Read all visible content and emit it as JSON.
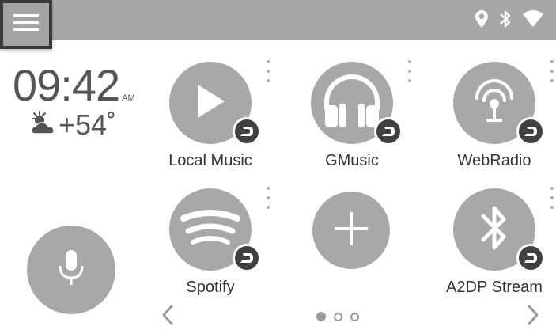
{
  "status_bar": {
    "icons": [
      "location-pin-icon",
      "bluetooth-icon",
      "wifi-icon"
    ]
  },
  "menu": {
    "icon": "hamburger-menu-icon"
  },
  "clock": {
    "time": "09:42",
    "ampm": "AM"
  },
  "weather": {
    "icon": "partly-cloudy-icon",
    "temperature": "+54˚"
  },
  "voice": {
    "icon": "microphone-icon"
  },
  "apps": [
    {
      "label": "Local Music",
      "icon": "play-icon",
      "badge": "player-badge-icon"
    },
    {
      "label": "GMusic",
      "icon": "headphones-icon",
      "badge": "player-badge-icon"
    },
    {
      "label": "WebRadio",
      "icon": "radio-antenna-icon",
      "badge": "player-badge-icon"
    },
    {
      "label": "Spotify",
      "icon": "spotify-icon",
      "badge": "player-badge-icon"
    },
    {
      "label": "",
      "icon": "add-icon"
    },
    {
      "label": "A2DP Stream",
      "icon": "bluetooth-icon",
      "badge": "player-badge-icon"
    }
  ],
  "pager": {
    "pages": 3,
    "current": 1
  },
  "colors": {
    "tile": "#a8a8a8",
    "bar": "#a6a6a6",
    "badge": "#404040",
    "text": "#333333"
  }
}
